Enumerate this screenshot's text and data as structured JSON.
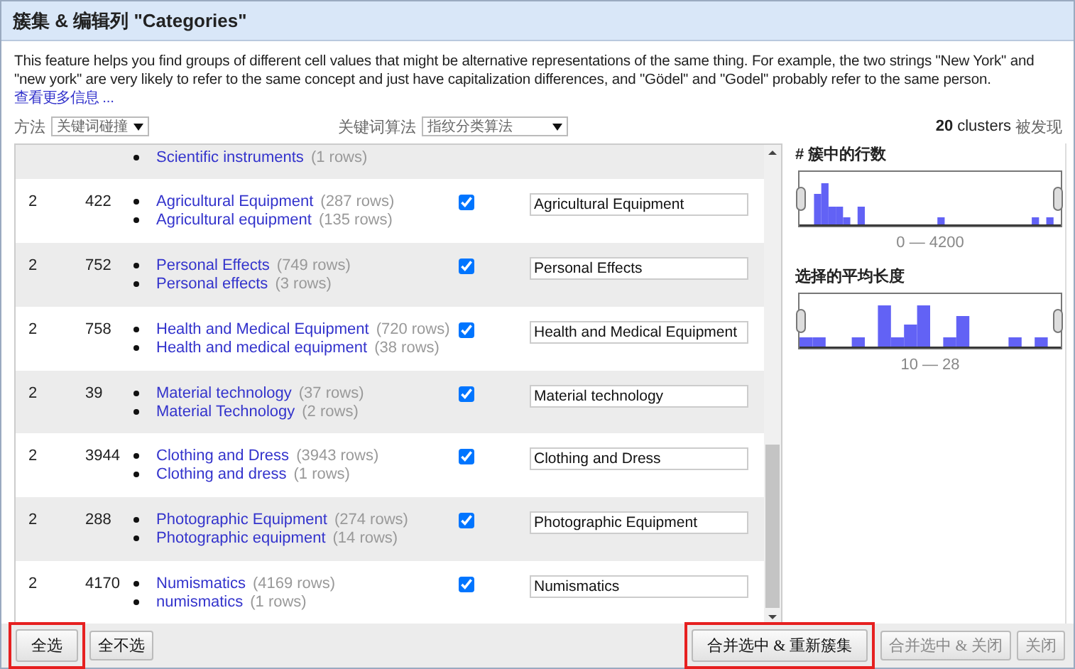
{
  "window": {
    "title": "簇集 & 编辑列 \"Categories\""
  },
  "description": {
    "text": "This feature helps you find groups of different cell values that might be alternative representations of the same thing. For example, the two strings \"New York\" and \"new york\" are very likely to refer to the same concept and just have capitalization differences, and \"Gödel\" and \"Godel\" probably refer to the same person.",
    "link": "查看更多信息 ..."
  },
  "controls": {
    "method_label": "方法",
    "method_value": "关键词碰撞",
    "function_label": "关键词算法",
    "function_value": "指纹分类算法",
    "clusters_count": "20",
    "clusters_word": "clusters",
    "clusters_suffix": "被发现"
  },
  "rows": [
    {
      "values": [
        {
          "text": "Scientific instruments",
          "count": "(1 rows)"
        }
      ]
    },
    {
      "size": "2",
      "row_count": "422",
      "values": [
        {
          "text": "Agricultural Equipment",
          "count": "(287 rows)"
        },
        {
          "text": "Agricultural equipment",
          "count": "(135 rows)"
        }
      ],
      "checked": true,
      "new_value": "Agricultural Equipment"
    },
    {
      "size": "2",
      "row_count": "752",
      "values": [
        {
          "text": "Personal Effects",
          "count": "(749 rows)"
        },
        {
          "text": "Personal effects",
          "count": "(3 rows)"
        }
      ],
      "checked": true,
      "new_value": "Personal Effects"
    },
    {
      "size": "2",
      "row_count": "758",
      "values": [
        {
          "text": "Health and Medical Equipment",
          "count": "(720 rows)"
        },
        {
          "text": "Health and medical equipment",
          "count": "(38 rows)"
        }
      ],
      "checked": true,
      "new_value": "Health and Medical Equipment"
    },
    {
      "size": "2",
      "row_count": "39",
      "values": [
        {
          "text": "Material technology",
          "count": "(37 rows)"
        },
        {
          "text": "Material Technology",
          "count": "(2 rows)"
        }
      ],
      "checked": true,
      "new_value": "Material technology"
    },
    {
      "size": "2",
      "row_count": "3944",
      "values": [
        {
          "text": "Clothing and Dress",
          "count": "(3943 rows)"
        },
        {
          "text": "Clothing and dress",
          "count": "(1 rows)"
        }
      ],
      "checked": true,
      "new_value": "Clothing and Dress"
    },
    {
      "size": "2",
      "row_count": "288",
      "values": [
        {
          "text": "Photographic Equipment",
          "count": "(274 rows)"
        },
        {
          "text": "Photographic equipment",
          "count": "(14 rows)"
        }
      ],
      "checked": true,
      "new_value": "Photographic Equipment"
    },
    {
      "size": "2",
      "row_count": "4170",
      "values": [
        {
          "text": "Numismatics",
          "count": "(4169 rows)"
        },
        {
          "text": "numismatics",
          "count": "(1 rows)"
        }
      ],
      "checked": true,
      "new_value": "Numismatics"
    }
  ],
  "facets": [
    {
      "title": "# 簇中的行数",
      "range": "0 — 4200",
      "kind": "rows"
    },
    {
      "title": "选择的平均长度",
      "range": "10 — 28",
      "kind": "length"
    }
  ],
  "buttons_left": [
    {
      "label": "全选",
      "highlighted": true,
      "disabled": false
    },
    {
      "label": "全不选",
      "highlighted": false,
      "disabled": false
    }
  ],
  "buttons_right": [
    {
      "label": "合并选中 & 重新簇集",
      "highlighted": true,
      "disabled": false
    },
    {
      "label": "合并选中 & 关闭",
      "highlighted": false,
      "disabled": true
    },
    {
      "label": "关闭",
      "highlighted": false,
      "disabled": true
    }
  ]
}
